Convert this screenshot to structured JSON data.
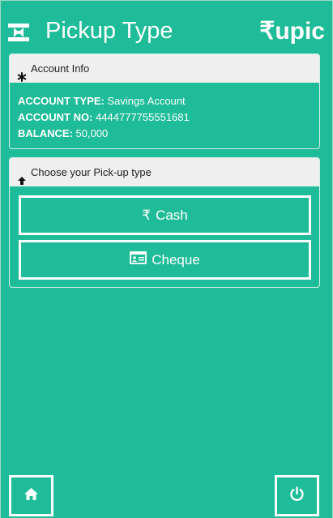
{
  "header": {
    "title": "Pickup Type",
    "brand": "₹upic",
    "logo_icon": "bank-note-icon"
  },
  "account_panel": {
    "heading": "Account Info",
    "heading_icon": "asterisk-icon",
    "type_label": "ACCOUNT TYPE:",
    "type_value": "Savings Account",
    "number_label": "ACCOUNT NO:",
    "number_value": "4444777755551681",
    "balance_label": "BALANCE:",
    "balance_value": "50,000"
  },
  "pickup_panel": {
    "heading": "Choose your Pick-up type",
    "heading_icon": "arrow-up-icon",
    "cash_symbol": "₹",
    "cash_label": "Cash",
    "cheque_label": "Cheque",
    "cheque_icon": "id-card-icon"
  },
  "footer": {
    "home_icon": "home-icon",
    "power_icon": "power-icon"
  },
  "colors": {
    "background": "#1ebc98",
    "panel_header": "#efefef",
    "text": "#ffffff"
  }
}
